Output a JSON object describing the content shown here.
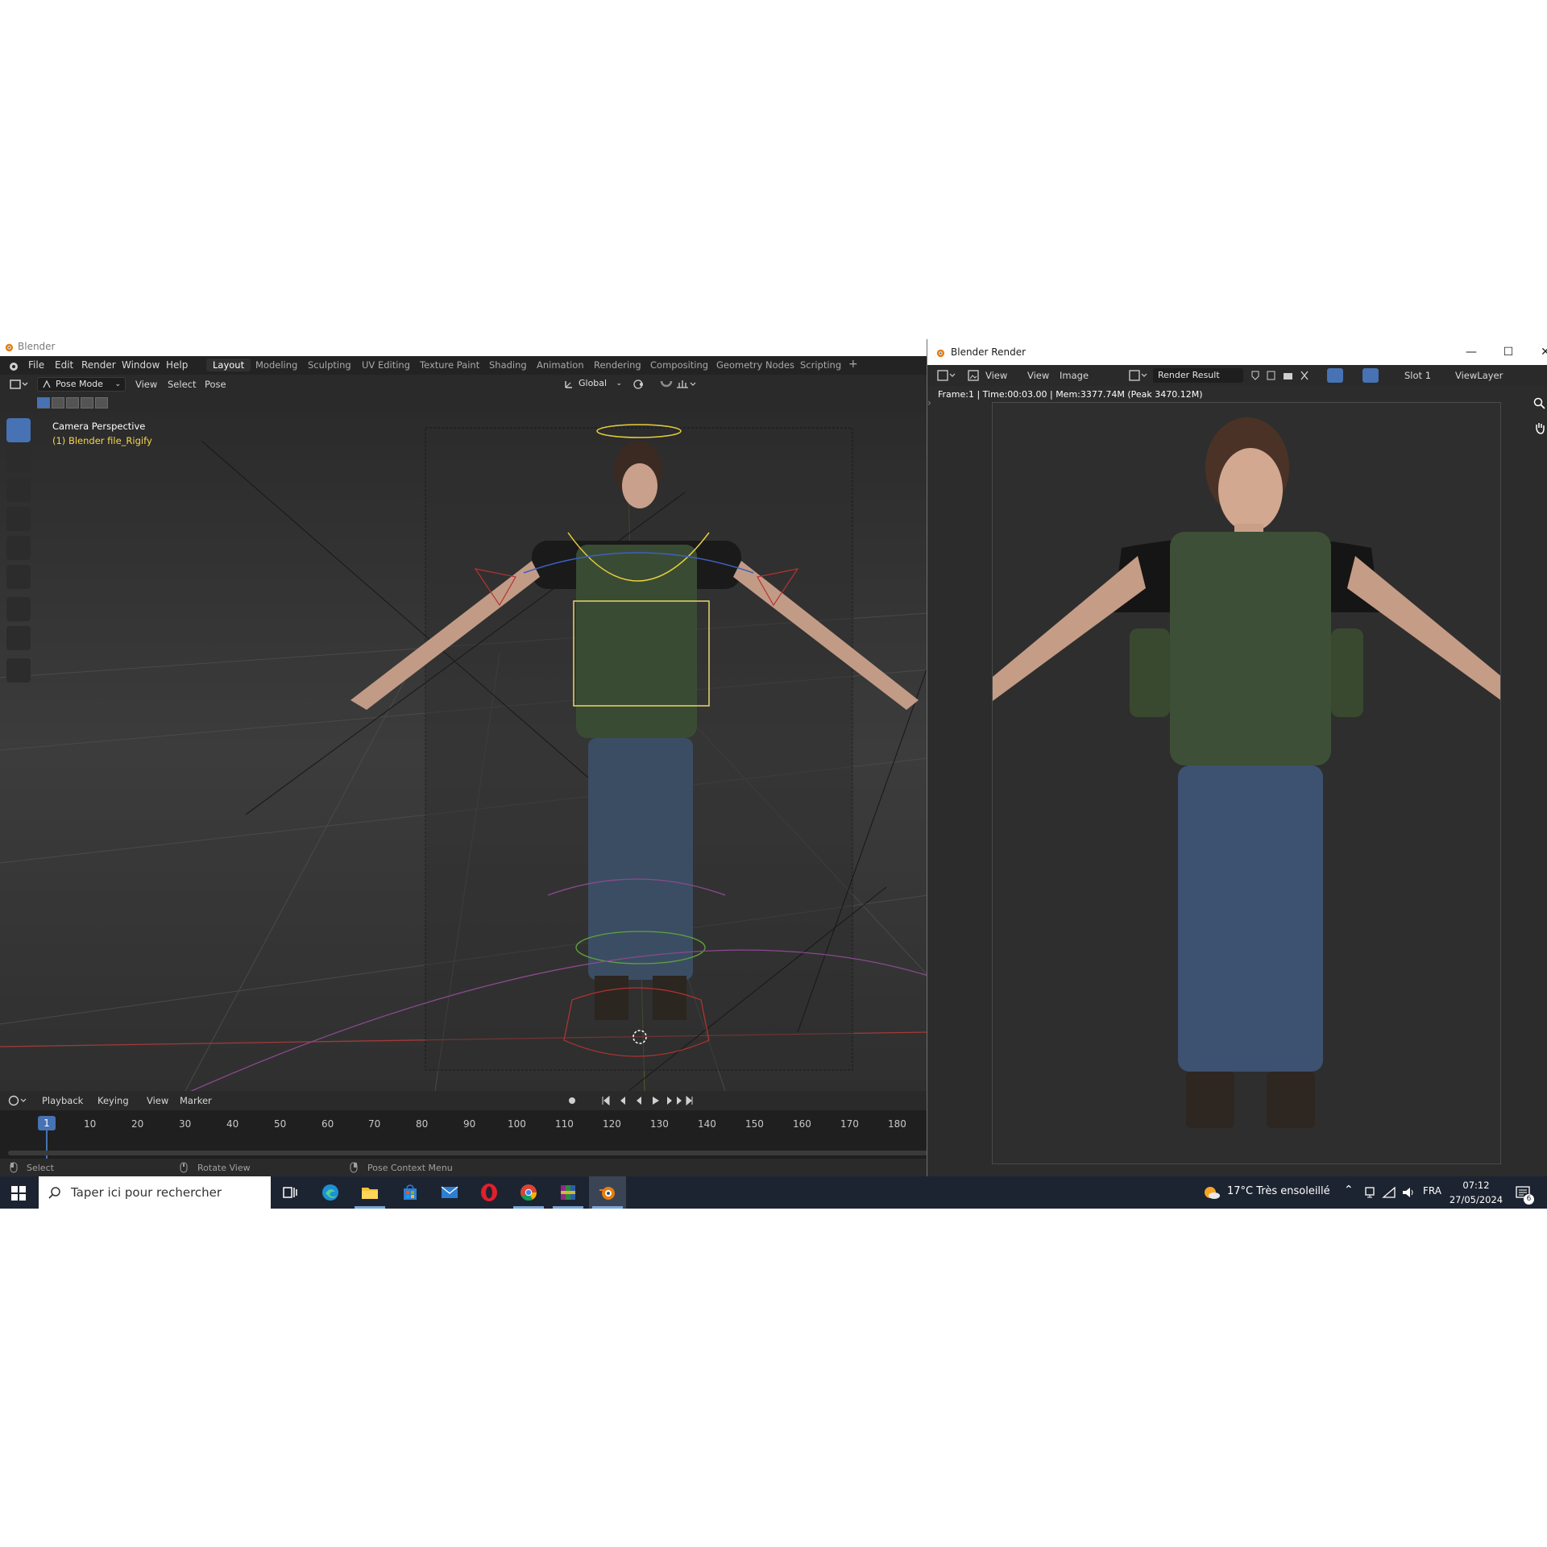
{
  "main_window": {
    "title": "Blender",
    "menu": [
      "File",
      "Edit",
      "Render",
      "Window",
      "Help"
    ],
    "workspaces": [
      "Layout",
      "Modeling",
      "Sculpting",
      "UV Editing",
      "Texture Paint",
      "Shading",
      "Animation",
      "Rendering",
      "Compositing",
      "Geometry Nodes",
      "Scripting"
    ],
    "active_workspace": "Layout",
    "add_workspace": "+",
    "header": {
      "mode": "Pose Mode",
      "menus": [
        "View",
        "Select",
        "Pose"
      ],
      "orientation": "Global"
    },
    "viewport": {
      "camera_label": "Camera Perspective",
      "object_label": "(1) Blender file_Rigify"
    },
    "timeline": {
      "menus": [
        "Playback",
        "Keying",
        "View",
        "Marker"
      ],
      "current_frame": "1",
      "ticks": [
        "10",
        "20",
        "30",
        "40",
        "50",
        "60",
        "70",
        "80",
        "90",
        "100",
        "110",
        "120",
        "130",
        "140",
        "150",
        "160",
        "170",
        "180"
      ]
    },
    "status": {
      "select": "Select",
      "rotate": "Rotate View",
      "context": "Pose Context Menu"
    }
  },
  "render_window": {
    "title": "Blender Render",
    "controls": [
      "—",
      "☐",
      "✕"
    ],
    "header": {
      "menus": [
        "View",
        "View",
        "Image"
      ],
      "image_name": "Render Result",
      "slot": "Slot 1",
      "view_layer": "ViewLayer"
    },
    "info": "Frame:1 | Time:00:03.00 | Mem:3377.74M (Peak 3470.12M)"
  },
  "taskbar": {
    "search_placeholder": "Taper ici pour rechercher",
    "weather": "17°C  Très ensoleillé",
    "language": "FRA",
    "time": "07:12",
    "date": "27/05/2024",
    "notifications": "6"
  }
}
